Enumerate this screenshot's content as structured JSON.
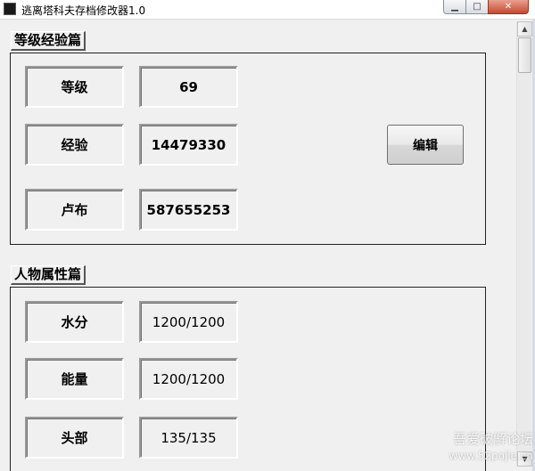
{
  "window": {
    "title": "逃离塔科夫存档修改器1.0",
    "min_glyph": "▁",
    "max_glyph": "□",
    "close_glyph": "✕"
  },
  "scrollbar": {
    "up_glyph": "▲",
    "down_glyph": "▼"
  },
  "level_section": {
    "title": "等级经验篇",
    "rows": [
      {
        "label": "等级",
        "value": "69"
      },
      {
        "label": "经验",
        "value": "14479330"
      },
      {
        "label": "卢布",
        "value": "587655253"
      }
    ],
    "edit_label": "编辑"
  },
  "attr_section": {
    "title": "人物属性篇",
    "rows": [
      {
        "label": "水分",
        "value": "1200/1200"
      },
      {
        "label": "能量",
        "value": "1200/1200"
      },
      {
        "label": "头部",
        "value": "135/135"
      }
    ]
  },
  "watermark": {
    "text": "吾爱破解论坛",
    "url": "www.52pojie.cn"
  }
}
